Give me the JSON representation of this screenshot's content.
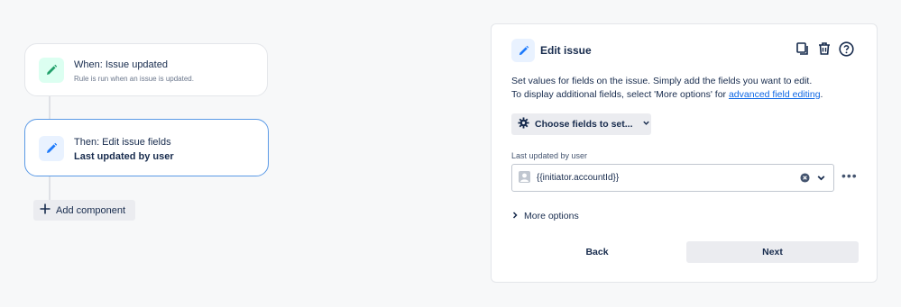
{
  "flow": {
    "trigger": {
      "title": "When: Issue updated",
      "subtitle": "Rule is run when an issue is updated.",
      "icon": "pencil-icon",
      "accent": "#1f845a"
    },
    "action": {
      "title": "Then: Edit issue fields",
      "detail": "Last updated by user",
      "icon": "pencil-icon",
      "accent": "#0c66e4"
    },
    "add_component_label": "Add component"
  },
  "panel": {
    "title": "Edit issue",
    "icons": [
      "duplicate-icon",
      "trash-icon",
      "help-icon"
    ],
    "description_line1": "Set values for fields on the issue. Simply add the fields you want to edit.",
    "description_line2_prefix": "To display additional fields, select 'More options' for ",
    "description_link": "advanced field editing",
    "description_line2_suffix": ".",
    "choose_fields_label": "Choose fields to set...",
    "field": {
      "label": "Last updated by user",
      "value": "{{initiator.accountId}}"
    },
    "more_options_label": "More options",
    "back_label": "Back",
    "next_label": "Next"
  }
}
